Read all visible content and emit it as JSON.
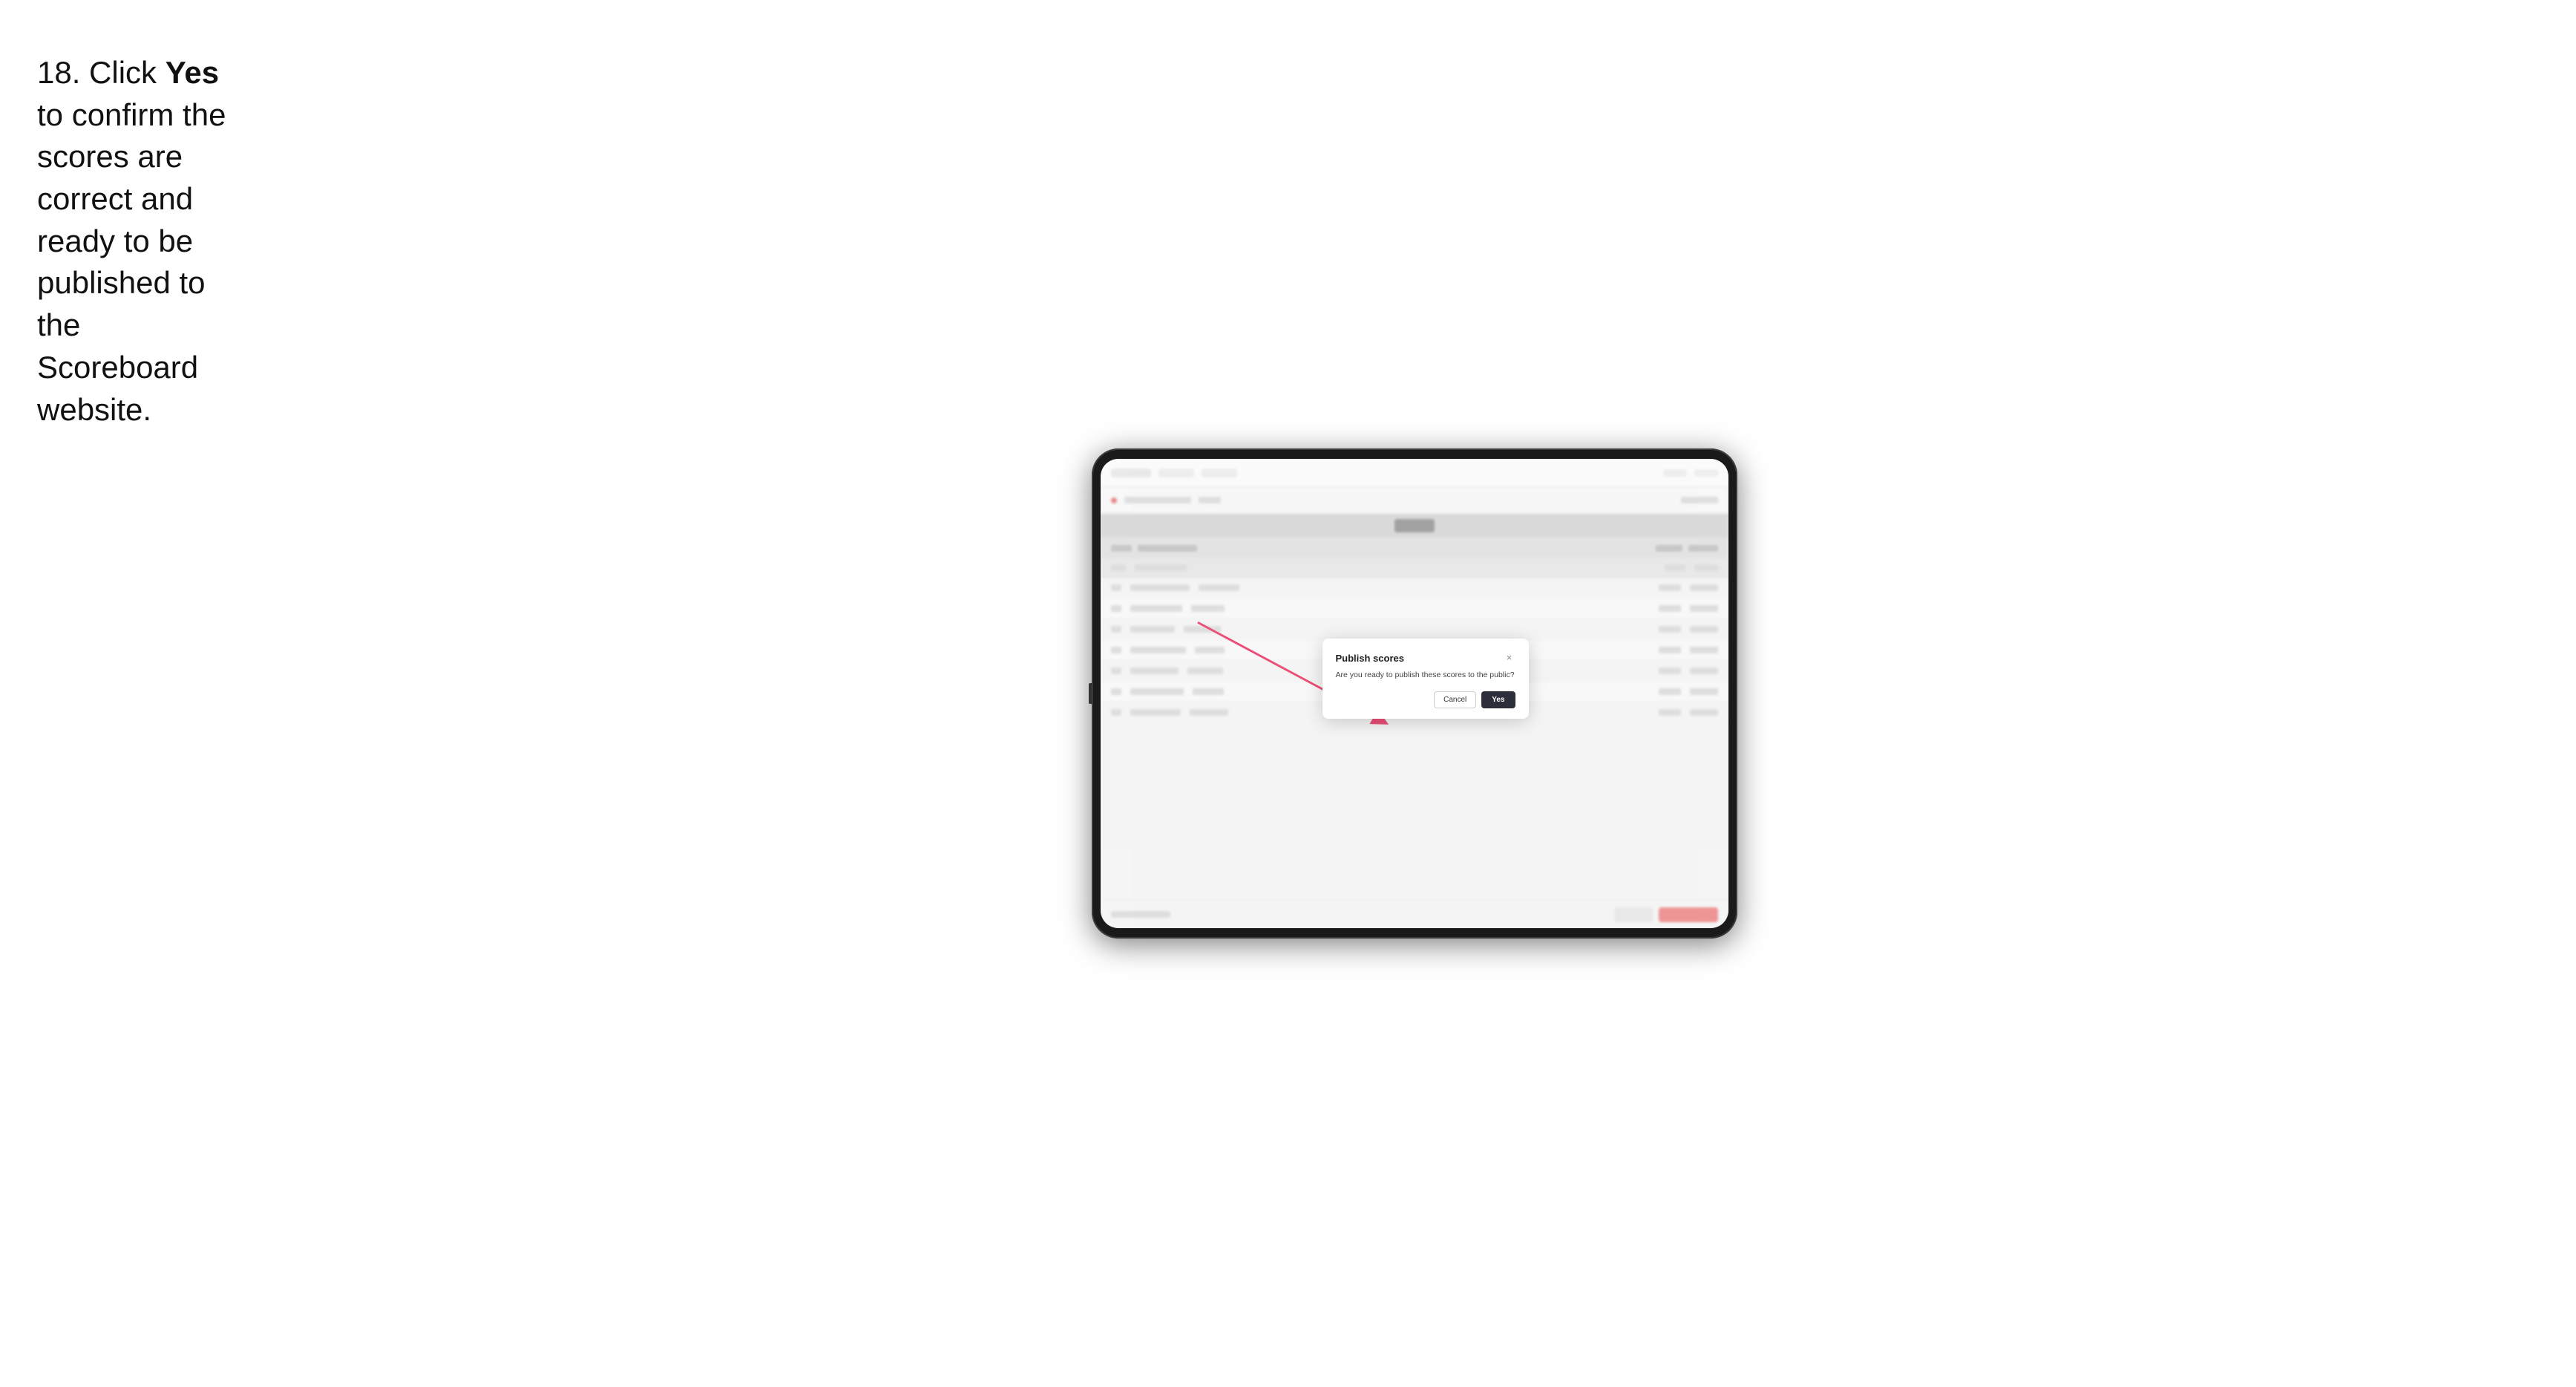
{
  "instruction": {
    "step_number": "18.",
    "text_part1": " Click ",
    "bold_word": "Yes",
    "text_part2": " to confirm the scores are correct and ready to be published to the Scoreboard website."
  },
  "modal": {
    "title": "Publish scores",
    "body": "Are you ready to publish these scores to the public?",
    "cancel_label": "Cancel",
    "yes_label": "Yes",
    "close_icon": "×"
  },
  "colors": {
    "yes_button_bg": "#2c2f3a",
    "yes_button_text": "#ffffff",
    "cancel_border": "#cccccc",
    "arrow_color": "#e83060"
  }
}
